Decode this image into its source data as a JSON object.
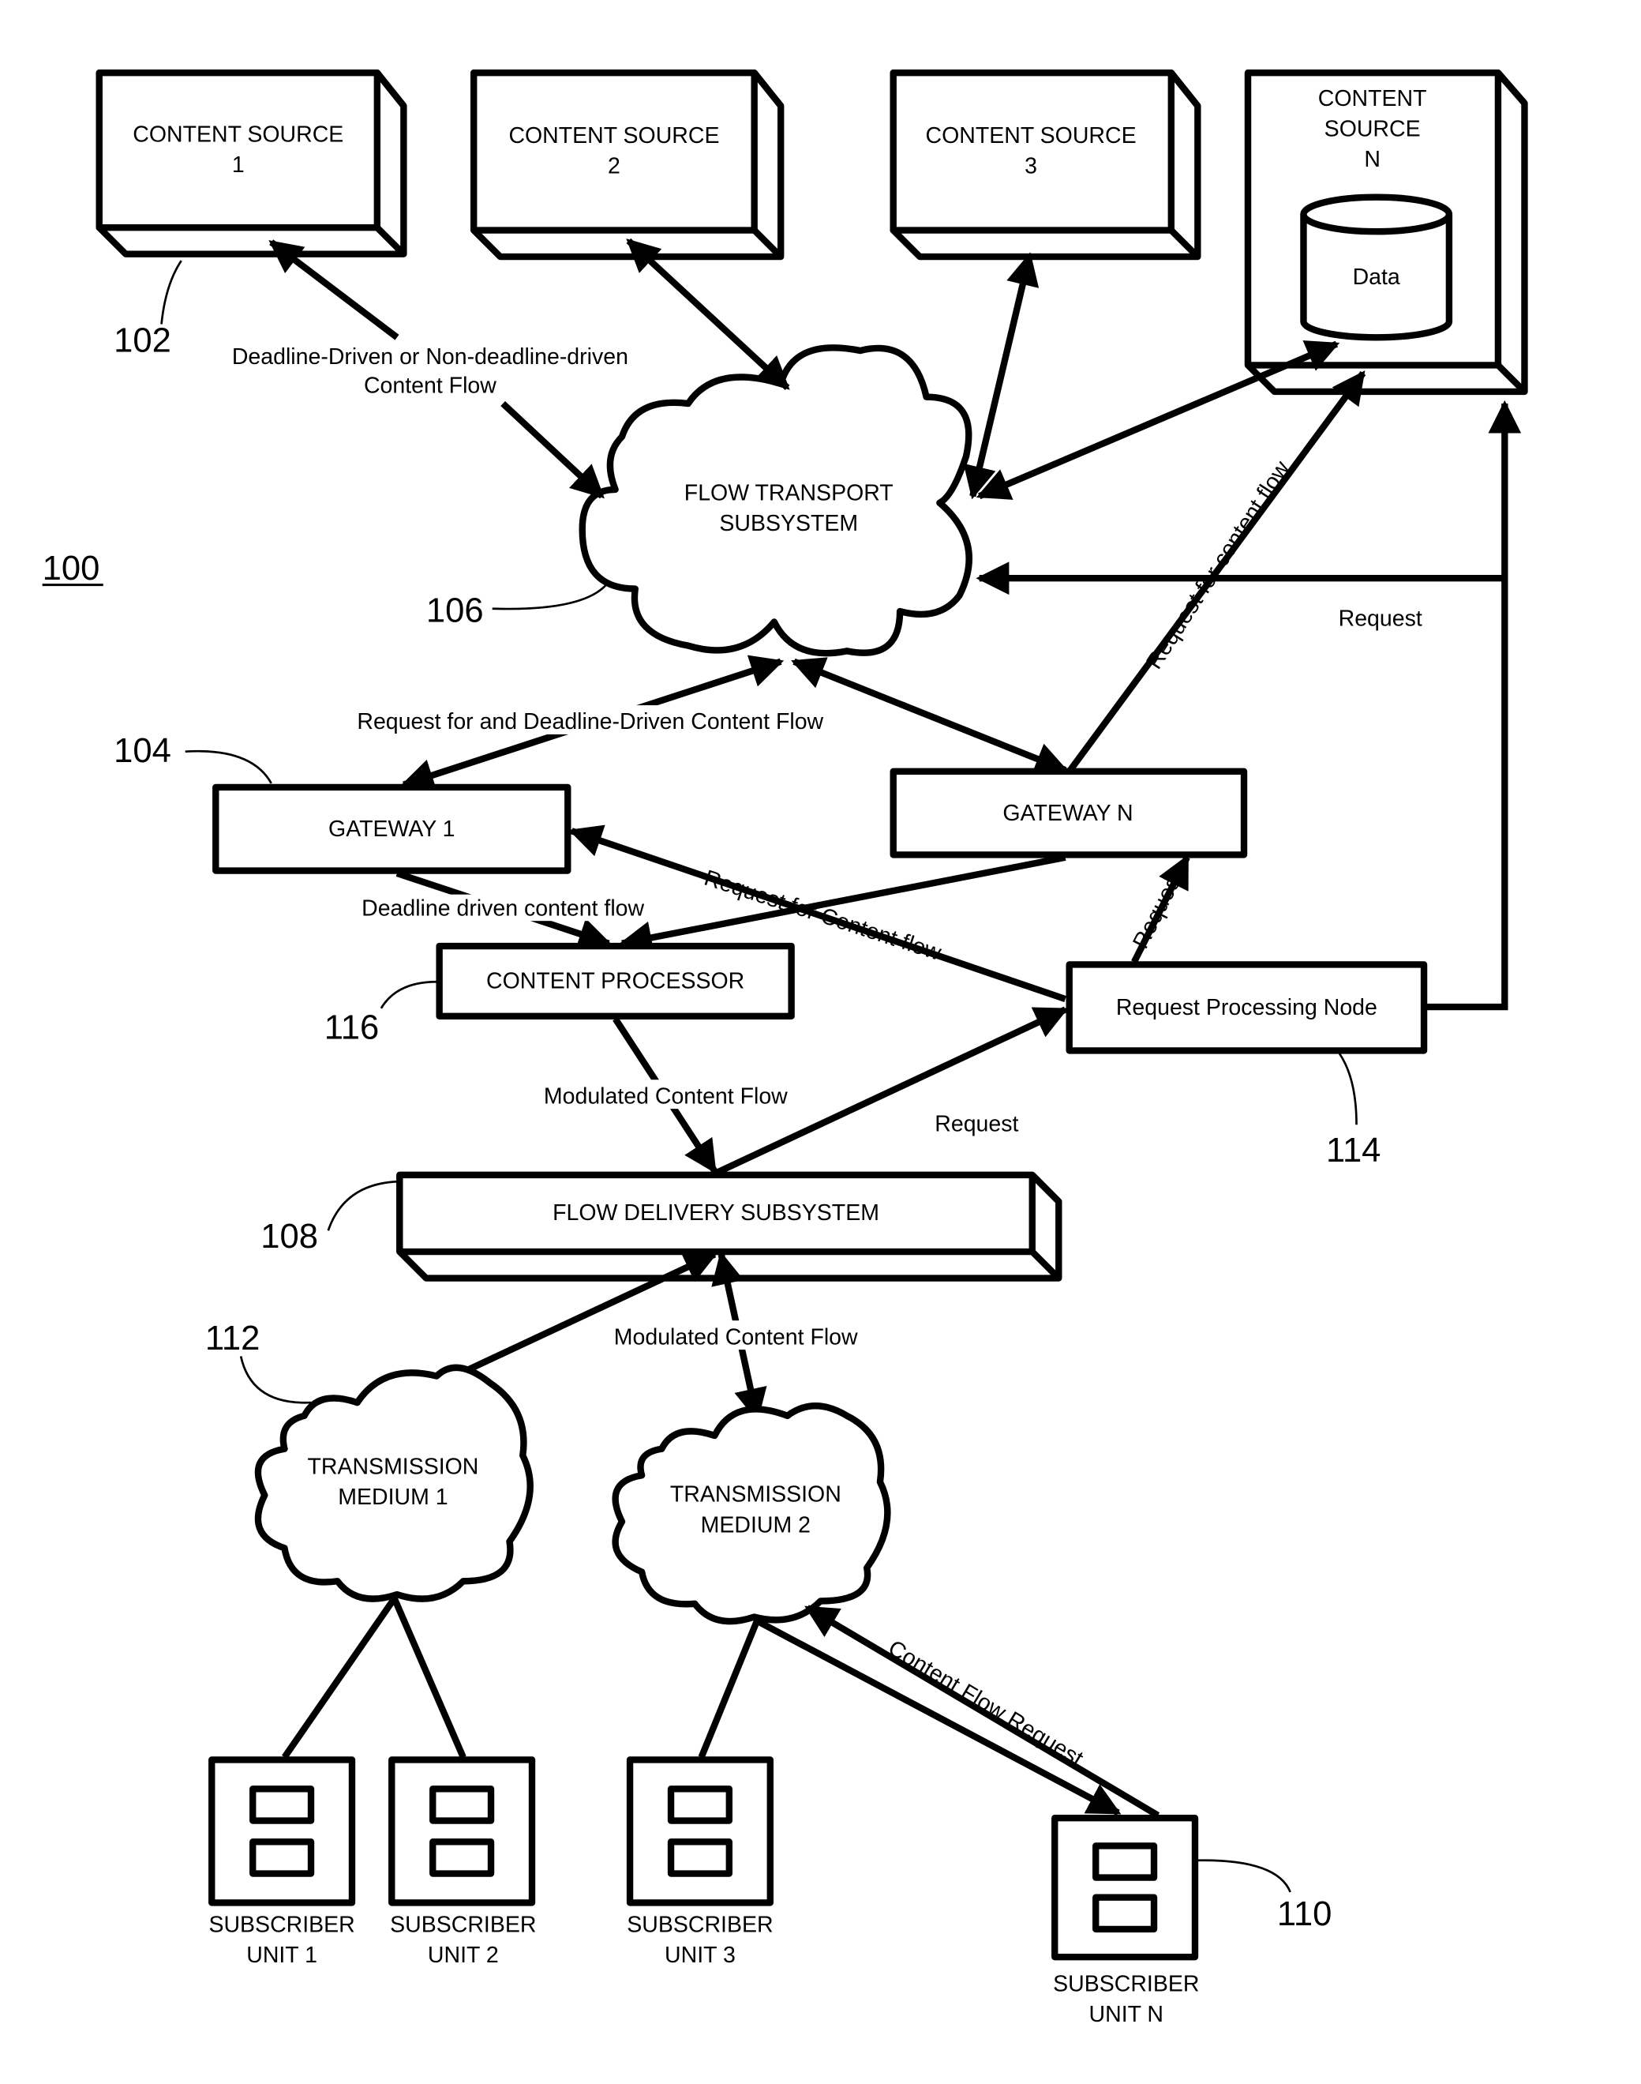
{
  "figure": {
    "reference": "100",
    "content_sources": [
      {
        "id": "cs1",
        "label": [
          "CONTENT SOURCE",
          "1"
        ],
        "ref": "102"
      },
      {
        "id": "cs2",
        "label": [
          "CONTENT SOURCE",
          "2"
        ]
      },
      {
        "id": "cs3",
        "label": [
          "CONTENT SOURCE",
          "3"
        ]
      },
      {
        "id": "csn",
        "label": [
          "CONTENT",
          "SOURCE",
          "N"
        ],
        "database_label": "Data"
      }
    ],
    "flow_transport": {
      "label": [
        "FLOW TRANSPORT",
        "SUBSYSTEM"
      ],
      "ref": "106"
    },
    "gateway_1": {
      "label": "GATEWAY 1",
      "ref": "104"
    },
    "gateway_n": {
      "label": "GATEWAY N"
    },
    "content_processor": {
      "label": "CONTENT PROCESSOR",
      "ref": "116"
    },
    "request_node": {
      "label": "Request Processing Node",
      "ref": "114"
    },
    "flow_delivery": {
      "label": "FLOW DELIVERY SUBSYSTEM",
      "ref": "108"
    },
    "transmission_1": {
      "label": [
        "TRANSMISSION",
        "MEDIUM 1"
      ],
      "ref": "112"
    },
    "transmission_2": {
      "label": [
        "TRANSMISSION",
        "MEDIUM 2"
      ]
    },
    "subscribers": [
      {
        "label": [
          "SUBSCRIBER",
          "UNIT 1"
        ]
      },
      {
        "label": [
          "SUBSCRIBER",
          "UNIT 2"
        ]
      },
      {
        "label": [
          "SUBSCRIBER",
          "UNIT 3"
        ]
      },
      {
        "label": [
          "SUBSCRIBER",
          "UNIT N"
        ],
        "ref": "110"
      }
    ],
    "edge_labels": {
      "deadline_flow": [
        "Deadline-Driven or Non-deadline-driven",
        "Content Flow"
      ],
      "request_and_deadline": "Request for and Deadline-Driven Content Flow",
      "deadline_driven_cf": "Deadline driven content flow",
      "request_for_content_flow_gw1": "Request for Content flow",
      "request_for_content_flow_csn": "Request for content flow",
      "request_right": "Request",
      "request_gwn": "Request",
      "request_fds": "Request",
      "modulated_1": "Modulated Content Flow",
      "modulated_2": "Modulated Content Flow",
      "content_flow_request": "Content Flow Request"
    }
  }
}
